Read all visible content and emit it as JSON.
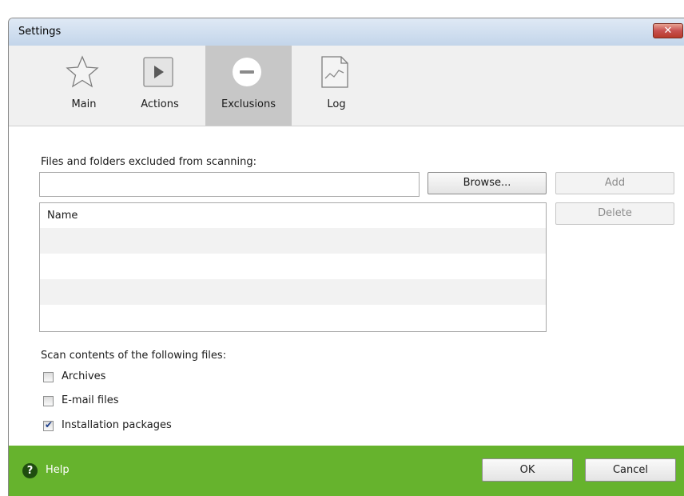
{
  "window": {
    "title": "Settings",
    "close_label": "✕"
  },
  "tabs": [
    {
      "label": "Main",
      "icon": "star-icon"
    },
    {
      "label": "Actions",
      "icon": "play-icon"
    },
    {
      "label": "Exclusions",
      "icon": "minus-circle-icon",
      "active": true
    },
    {
      "label": "Log",
      "icon": "log-document-icon"
    }
  ],
  "exclusions": {
    "section_label": "Files and folders excluded from scanning:",
    "path_value": "",
    "browse_label": "Browse...",
    "add_label": "Add",
    "delete_label": "Delete",
    "list_header": "Name",
    "rows": []
  },
  "scan": {
    "section_label": "Scan contents of the following files:",
    "options": [
      {
        "label": "Archives",
        "checked": false
      },
      {
        "label": "E-mail files",
        "checked": false
      },
      {
        "label": "Installation packages",
        "checked": true
      }
    ]
  },
  "footer": {
    "help_label": "Help",
    "ok_label": "OK",
    "cancel_label": "Cancel"
  },
  "colors": {
    "footer": "#66b32d",
    "active_tab": "#c7c7c7",
    "titlebar": "#c3d5ea"
  }
}
